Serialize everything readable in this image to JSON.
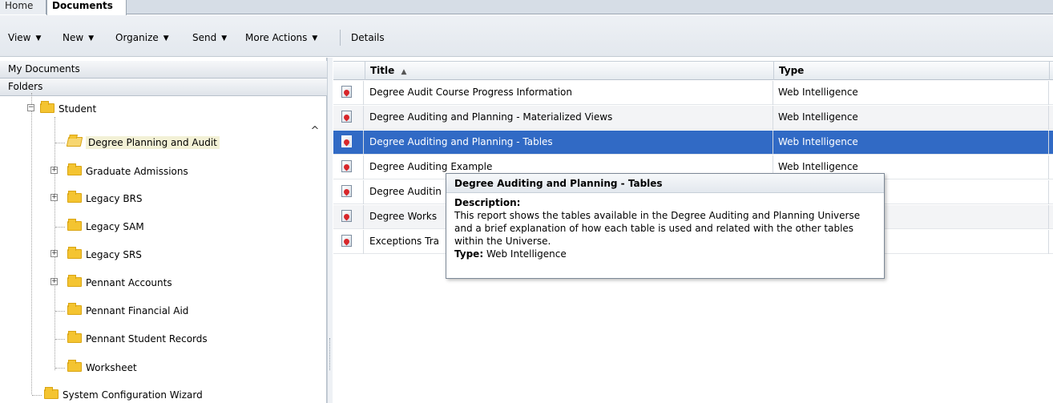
{
  "tabs": {
    "home": "Home",
    "documents": "Documents"
  },
  "toolbar": {
    "view": "View",
    "new": "New",
    "organize": "Organize",
    "send": "Send",
    "more_actions": "More Actions",
    "details": "Details"
  },
  "left": {
    "my_documents": "My Documents",
    "folders": "Folders",
    "tree": {
      "student": "Student",
      "children": [
        "Degree Planning and Audit",
        "Graduate Admissions",
        "Legacy BRS",
        "Legacy SAM",
        "Legacy SRS",
        "Pennant Accounts",
        "Pennant Financial Aid",
        "Pennant Student Records",
        "Worksheet"
      ],
      "system_config": "System Configuration Wizard"
    }
  },
  "grid": {
    "columns": {
      "title": "Title",
      "sort_indicator": "▲",
      "type": "Type"
    },
    "rows": [
      {
        "title": "Degree Audit Course Progress Information",
        "type": "Web Intelligence"
      },
      {
        "title": "Degree Auditing and Planning - Materialized Views",
        "type": "Web Intelligence"
      },
      {
        "title": "Degree Auditing and Planning - Tables",
        "type": "Web Intelligence"
      },
      {
        "title": "Degree Auditing Example",
        "type": "Web Intelligence"
      },
      {
        "title": "Degree Auditin",
        "type": ""
      },
      {
        "title": "Degree Works",
        "type": ""
      },
      {
        "title": "Exceptions Tra",
        "type": ""
      }
    ]
  },
  "tooltip": {
    "title": "Degree Auditing and Planning - Tables",
    "description_label": "Description:",
    "description": "This report shows the tables available in the Degree Auditing and Planning Universe and a brief explanation of how each table is used and related with the other tables within the Universe.",
    "type_label": "Type:",
    "type_value": "Web Intelligence"
  }
}
